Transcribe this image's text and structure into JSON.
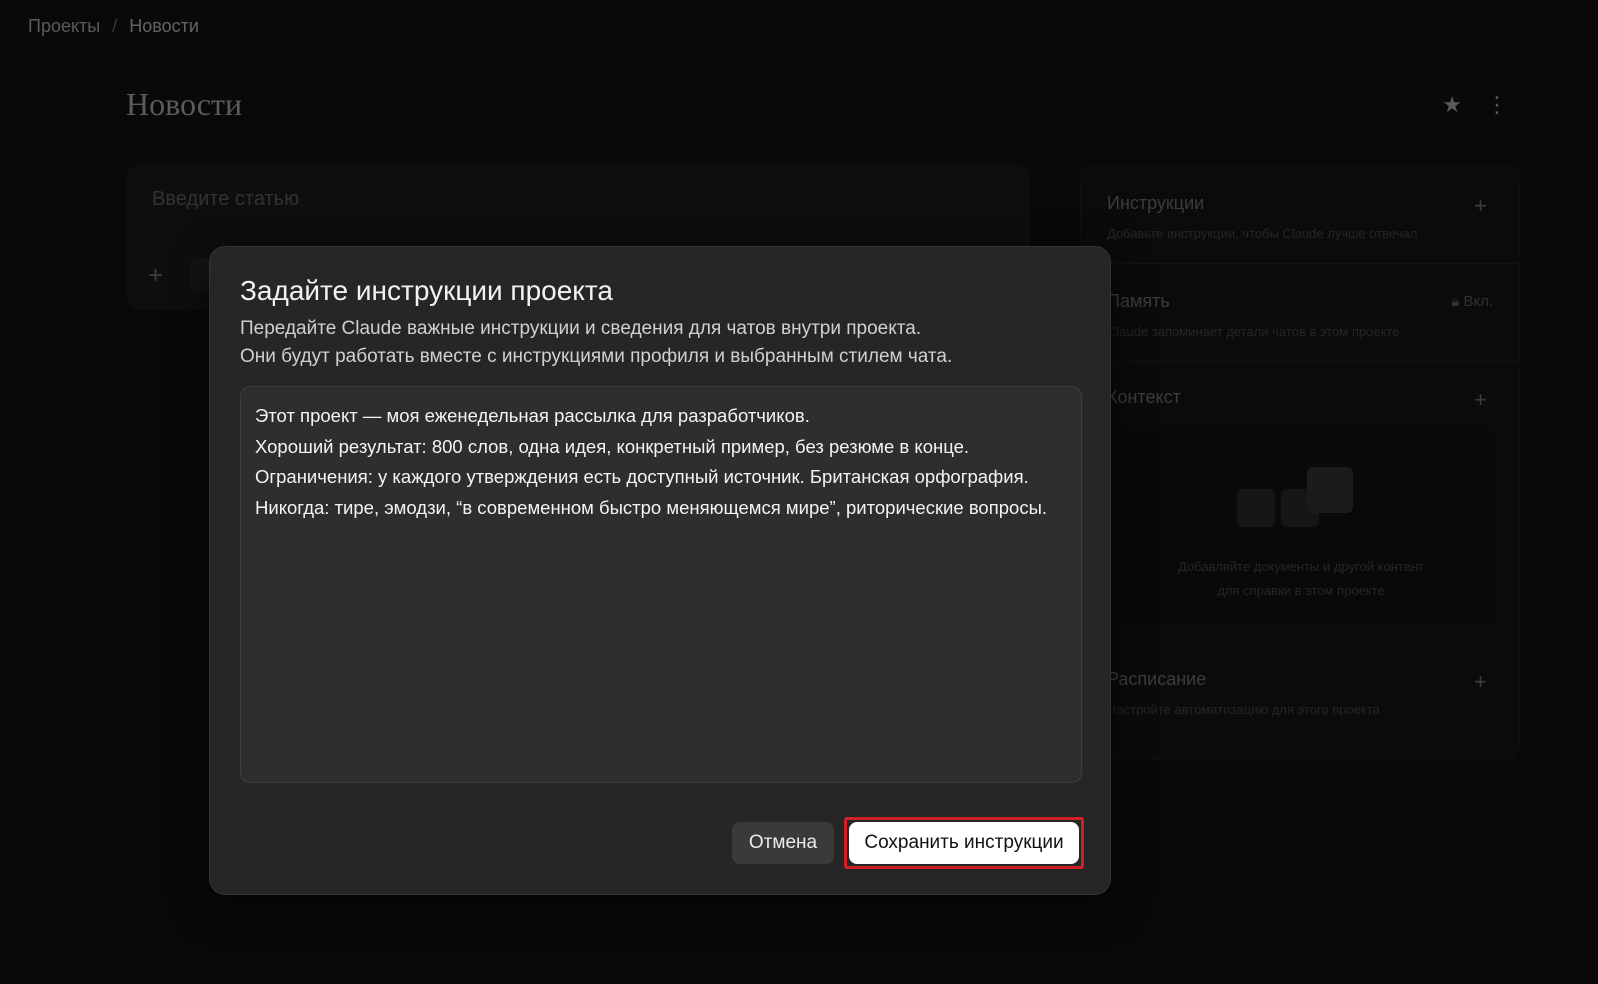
{
  "breadcrumb": {
    "root": "Проекты",
    "separator": "/",
    "current": "Новости"
  },
  "page": {
    "title": "Новости",
    "star_icon": "star-icon",
    "menu_icon": "kebab-menu-icon"
  },
  "composer": {
    "placeholder": "Введите статью"
  },
  "side_panel": {
    "instructions": {
      "title": "Инструкции",
      "desc": "Добавьте инструкции, чтобы Claude лучше отвечал"
    },
    "memory": {
      "title": "Память",
      "status": "Вкл.",
      "desc": "Claude запоминает детали чатов в этом проекте"
    },
    "context": {
      "title": "Контекст",
      "empty_line1": "Добавляйте документы и другой контент",
      "empty_line2": "для справки в этом проекте"
    },
    "schedule": {
      "title": "Расписание",
      "desc": "Настройте автоматизацию для этого проекта"
    }
  },
  "modal": {
    "title": "Задайте инструкции проекта",
    "subtitle_line1": "Передайте Claude важные инструкции и сведения для чатов внутри проекта.",
    "subtitle_line2": "Они будут работать вместе с инструкциями профиля и выбранным стилем чата.",
    "instructions_lines": [
      "Этот проект — моя еженедельная рассылка для разработчиков.",
      "Хороший результат: 800 слов, одна идея, конкретный пример, без резюме в конце.",
      "Ограничения: у каждого утверждения есть доступный источник. Британская орфография.",
      "Никогда: тире, эмодзи, “в современном быстро меняющемся мире”, риторические вопросы."
    ],
    "cancel_label": "Отмена",
    "save_label": "Сохранить инструкции"
  },
  "colors": {
    "highlight": "#d01f26",
    "modal_bg": "#262626",
    "page_bg": "#0e0e0e"
  }
}
